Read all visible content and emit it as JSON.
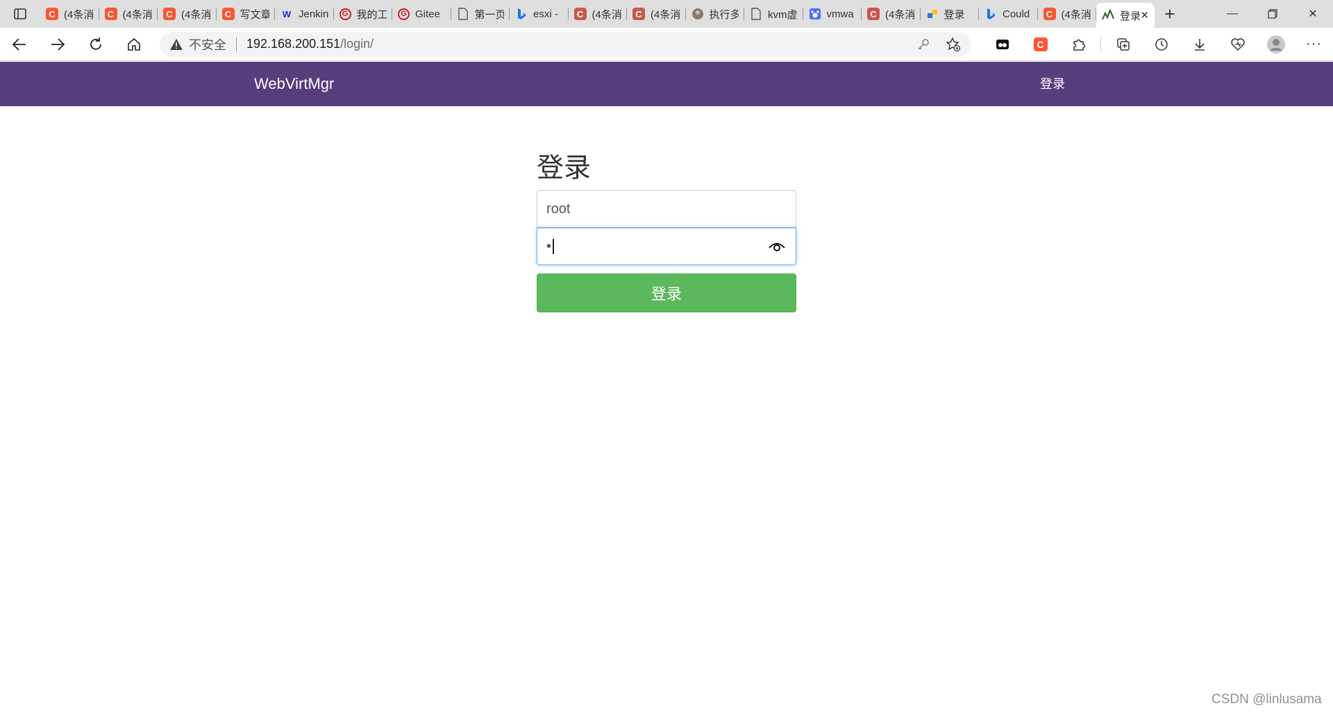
{
  "browser": {
    "tabs": [
      {
        "title": "(4条消",
        "icon": "csdn-icon",
        "color": "#fc5531"
      },
      {
        "title": "(4条消",
        "icon": "csdn-icon",
        "color": "#fc5531"
      },
      {
        "title": "(4条消",
        "icon": "csdn-icon",
        "color": "#fc5531"
      },
      {
        "title": "写文章",
        "icon": "csdn-icon",
        "color": "#fc5531"
      },
      {
        "title": "Jenkins",
        "icon": "w-icon",
        "color": "#1e2bd6"
      },
      {
        "title": "我的工",
        "icon": "gitee-icon",
        "color": "#c71d23"
      },
      {
        "title": "Gitee",
        "icon": "gitee-icon",
        "color": "#c71d23"
      },
      {
        "title": "第一页",
        "icon": "page-icon",
        "color": "#666666"
      },
      {
        "title": "esxi -",
        "icon": "bing-icon",
        "color": "#1a73e8"
      },
      {
        "title": "(4条消",
        "icon": "csdn-icon",
        "color": "#c9574a"
      },
      {
        "title": "(4条消",
        "icon": "csdn-icon",
        "color": "#c9574a"
      },
      {
        "title": "执行多",
        "icon": "avatar-icon",
        "color": "#8a7a6a"
      },
      {
        "title": "kvm虚",
        "icon": "page-icon",
        "color": "#666666"
      },
      {
        "title": "vmwa",
        "icon": "baidu-icon",
        "color": "#4e6ef2"
      },
      {
        "title": "(4条消",
        "icon": "csdn-icon",
        "color": "#c9574a"
      },
      {
        "title": "登录",
        "icon": "puzzle-icon",
        "color": "#f2c500"
      },
      {
        "title": "Could",
        "icon": "bing-icon",
        "color": "#1a73e8"
      },
      {
        "title": "(4条消",
        "icon": "csdn-icon",
        "color": "#fc5531"
      }
    ],
    "active_tab": {
      "title": "登录"
    },
    "address": {
      "insecure_label": "不安全",
      "host": "192.168.200.151",
      "path": "/login/"
    }
  },
  "page": {
    "brand": "WebVirtMgr",
    "nav_login": "登录",
    "form": {
      "title": "登录",
      "username_value": "root",
      "password_value": "•",
      "submit_label": "登录"
    },
    "accent_color": "#563d7c",
    "button_color": "#5cb85c"
  },
  "watermark": "CSDN @linlusama"
}
